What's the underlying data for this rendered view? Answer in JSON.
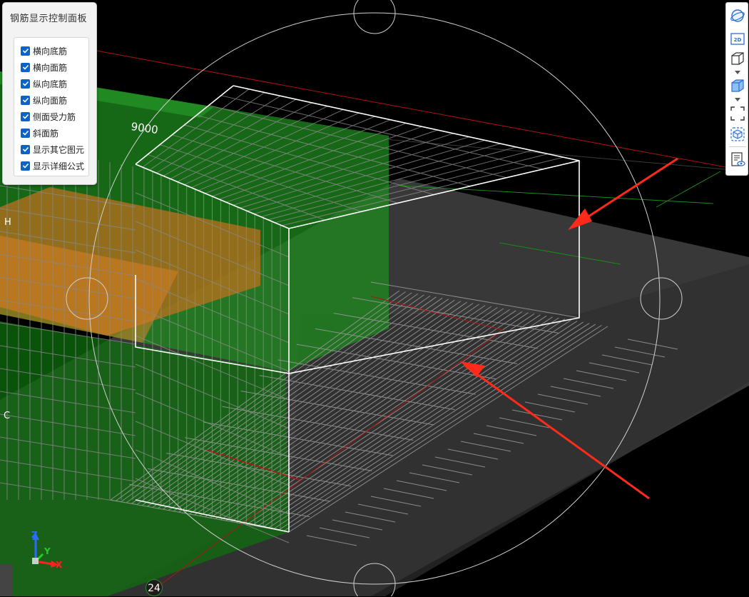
{
  "panel": {
    "title": "钢筋显示控制面板",
    "options": [
      {
        "label": "横向底筋",
        "checked": true
      },
      {
        "label": "横向面筋",
        "checked": true
      },
      {
        "label": "纵向底筋",
        "checked": true
      },
      {
        "label": "纵向面筋",
        "checked": true
      },
      {
        "label": "侧面受力筋",
        "checked": true
      },
      {
        "label": "斜面筋",
        "checked": true
      },
      {
        "label": "显示其它图元",
        "checked": true
      },
      {
        "label": "显示详细公式",
        "checked": true
      }
    ]
  },
  "toolbar": {
    "items": [
      {
        "icon": "orbit-icon"
      },
      {
        "icon": "2d-view-icon",
        "text": "2D"
      },
      {
        "icon": "cube-view-icon"
      },
      {
        "icon": "solid-cube-icon"
      },
      {
        "icon": "zoom-extents-icon"
      },
      {
        "icon": "isolate-icon"
      },
      {
        "icon": "display-settings-icon"
      }
    ]
  },
  "scene": {
    "dimension_label": "9000",
    "grid_label_h": "H",
    "grid_label_c": "C",
    "grid_bubble": "24",
    "axis": {
      "x": "X",
      "y": "Y",
      "z": "Z"
    }
  },
  "colors": {
    "accent": "#0b62c8",
    "slab": "#3a3a3a",
    "green_region": "#1f7a1f",
    "orange_region": "#c8701e",
    "arrow": "#ff2a1a"
  }
}
